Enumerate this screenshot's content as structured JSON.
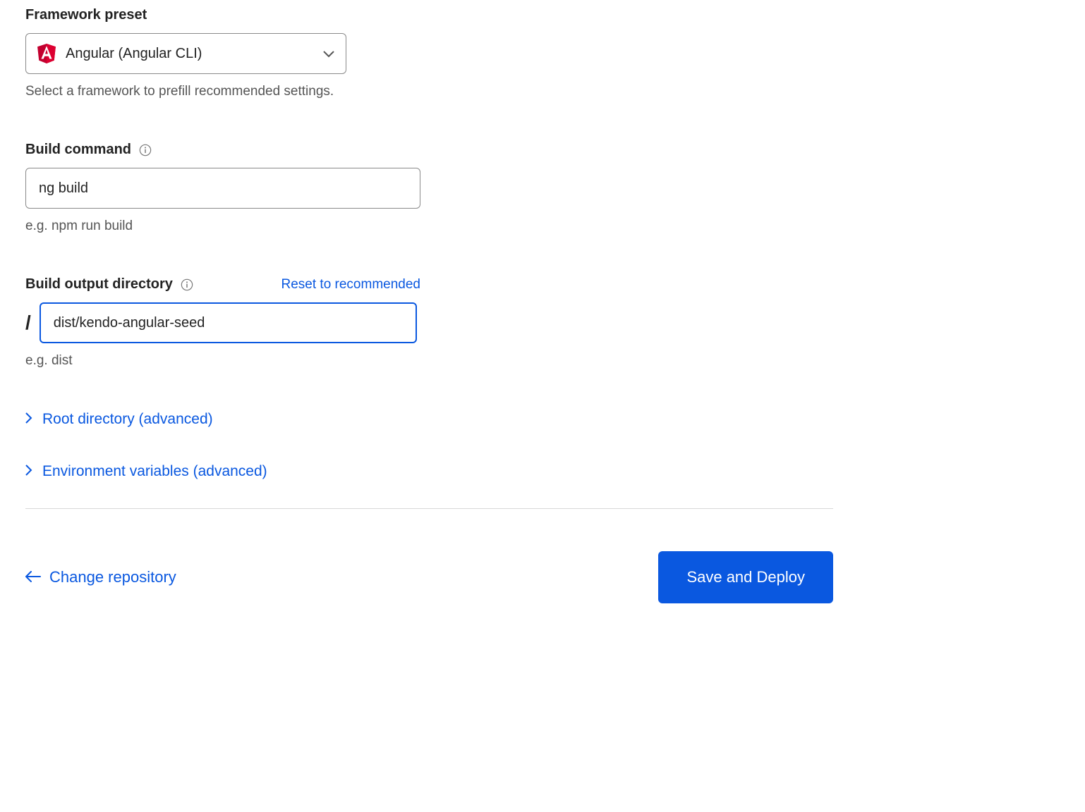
{
  "framework_preset": {
    "label": "Framework preset",
    "selected": "Angular (Angular CLI)",
    "help": "Select a framework to prefill recommended settings."
  },
  "build_command": {
    "label": "Build command",
    "value": "ng build",
    "help": "e.g. npm run build"
  },
  "build_output": {
    "label": "Build output directory",
    "reset_link": "Reset to recommended",
    "prefix": "/",
    "value": "dist/kendo-angular-seed",
    "help": "e.g. dist"
  },
  "advanced": {
    "root_dir": "Root directory (advanced)",
    "env_vars": "Environment variables (advanced)"
  },
  "footer": {
    "change_repo": "Change repository",
    "save_deploy": "Save and Deploy"
  }
}
